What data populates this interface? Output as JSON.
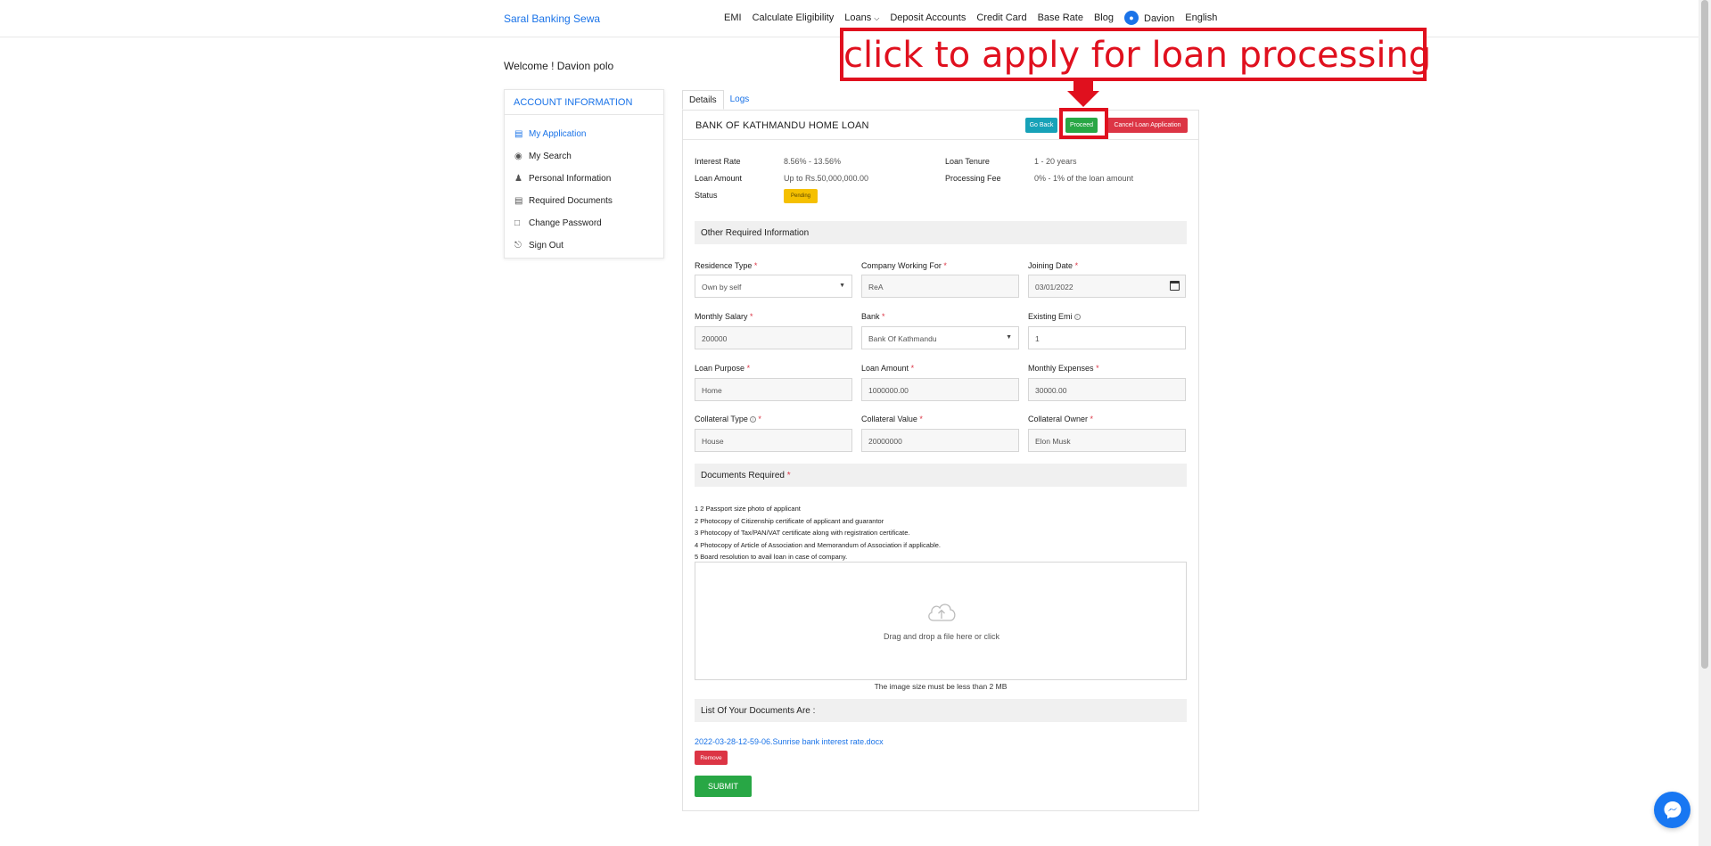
{
  "navbar": {
    "brand": "Saral Banking Sewa",
    "links": {
      "emi": "EMI",
      "calculate_eligibility": "Calculate Eligibility",
      "loans": "Loans",
      "deposit_accounts": "Deposit Accounts",
      "credit_card": "Credit Card",
      "base_rate": "Base Rate",
      "blog": "Blog",
      "user": "Davion",
      "language": "English"
    }
  },
  "welcome": "Welcome ! Davion polo",
  "sidebar": {
    "heading": "ACCOUNT INFORMATION",
    "items": [
      {
        "label": "My Application",
        "icon": "calendar-icon"
      },
      {
        "label": "My Search",
        "icon": "globe-icon"
      },
      {
        "label": "Personal Information",
        "icon": "user-icon"
      },
      {
        "label": "Required Documents",
        "icon": "document-icon"
      },
      {
        "label": "Change Password",
        "icon": "lock-icon"
      },
      {
        "label": "Sign Out",
        "icon": "power-icon"
      }
    ]
  },
  "tabs": {
    "details": "Details",
    "logs": "Logs"
  },
  "loan": {
    "title": "BANK OF KATHMANDU HOME LOAN",
    "buttons": {
      "go_back": "Go Back",
      "proceed": "Proceed",
      "cancel": "Cancel Loan Application"
    },
    "interest_rate_label": "Interest Rate",
    "interest_rate": "8.56% - 13.56%",
    "loan_amount_label": "Loan Amount",
    "loan_amount": "Up to Rs.50,000,000.00",
    "status_label": "Status",
    "status": "Pending",
    "tenure_label": "Loan Tenure",
    "tenure": "1 - 20 years",
    "processing_fee_label": "Processing Fee",
    "processing_fee": "0% - 1% of the loan amount"
  },
  "form": {
    "section_title": "Other Required Information",
    "residence_type": {
      "label": "Residence Type",
      "value": "Own by self"
    },
    "company": {
      "label": "Company Working For",
      "value": "ReA"
    },
    "joining_date": {
      "label": "Joining Date",
      "value": "03/01/2022"
    },
    "monthly_salary": {
      "label": "Monthly Salary",
      "value": "200000"
    },
    "bank": {
      "label": "Bank",
      "value": "Bank Of Kathmandu"
    },
    "existing_emi": {
      "label": "Existing Emi",
      "value": "1"
    },
    "loan_purpose": {
      "label": "Loan Purpose",
      "value": "Home"
    },
    "loan_amount": {
      "label": "Loan Amount",
      "value": "1000000.00"
    },
    "monthly_expenses": {
      "label": "Monthly Expenses",
      "value": "30000.00"
    },
    "collateral_type": {
      "label": "Collateral Type",
      "value": "House"
    },
    "collateral_value": {
      "label": "Collateral Value",
      "value": "20000000"
    },
    "collateral_owner": {
      "label": "Collateral Owner",
      "value": "Elon Musk"
    }
  },
  "documents": {
    "section_title": "Documents Required",
    "list": [
      "1 2 Passport size photo of applicant",
      "2 Photocopy of Citizenship certificate of applicant and guarantor",
      "3 Photocopy of Tax/PAN/VAT certificate along with registration certificate.",
      "4 Photocopy of Article of Association and Memorandum of Association if applicable.",
      "5 Board resolution to avail loan in case of company."
    ],
    "dropzone_text": "Drag and drop a file here or click",
    "size_note": "The image size must be less than 2 MB",
    "your_docs_title": "List Of Your Documents Are :",
    "file_name": "2022-03-28-12-59-06.Sunrise bank interest rate.docx",
    "remove_label": "Remove",
    "submit_label": "SUBMIT"
  },
  "annotation": {
    "text": "click to apply for loan processing",
    "color": "#e0101e"
  },
  "colors": {
    "accent": "#1a73e8",
    "success": "#28a745",
    "danger": "#dc3545",
    "info": "#17a2b8",
    "warning": "#f5c000"
  }
}
